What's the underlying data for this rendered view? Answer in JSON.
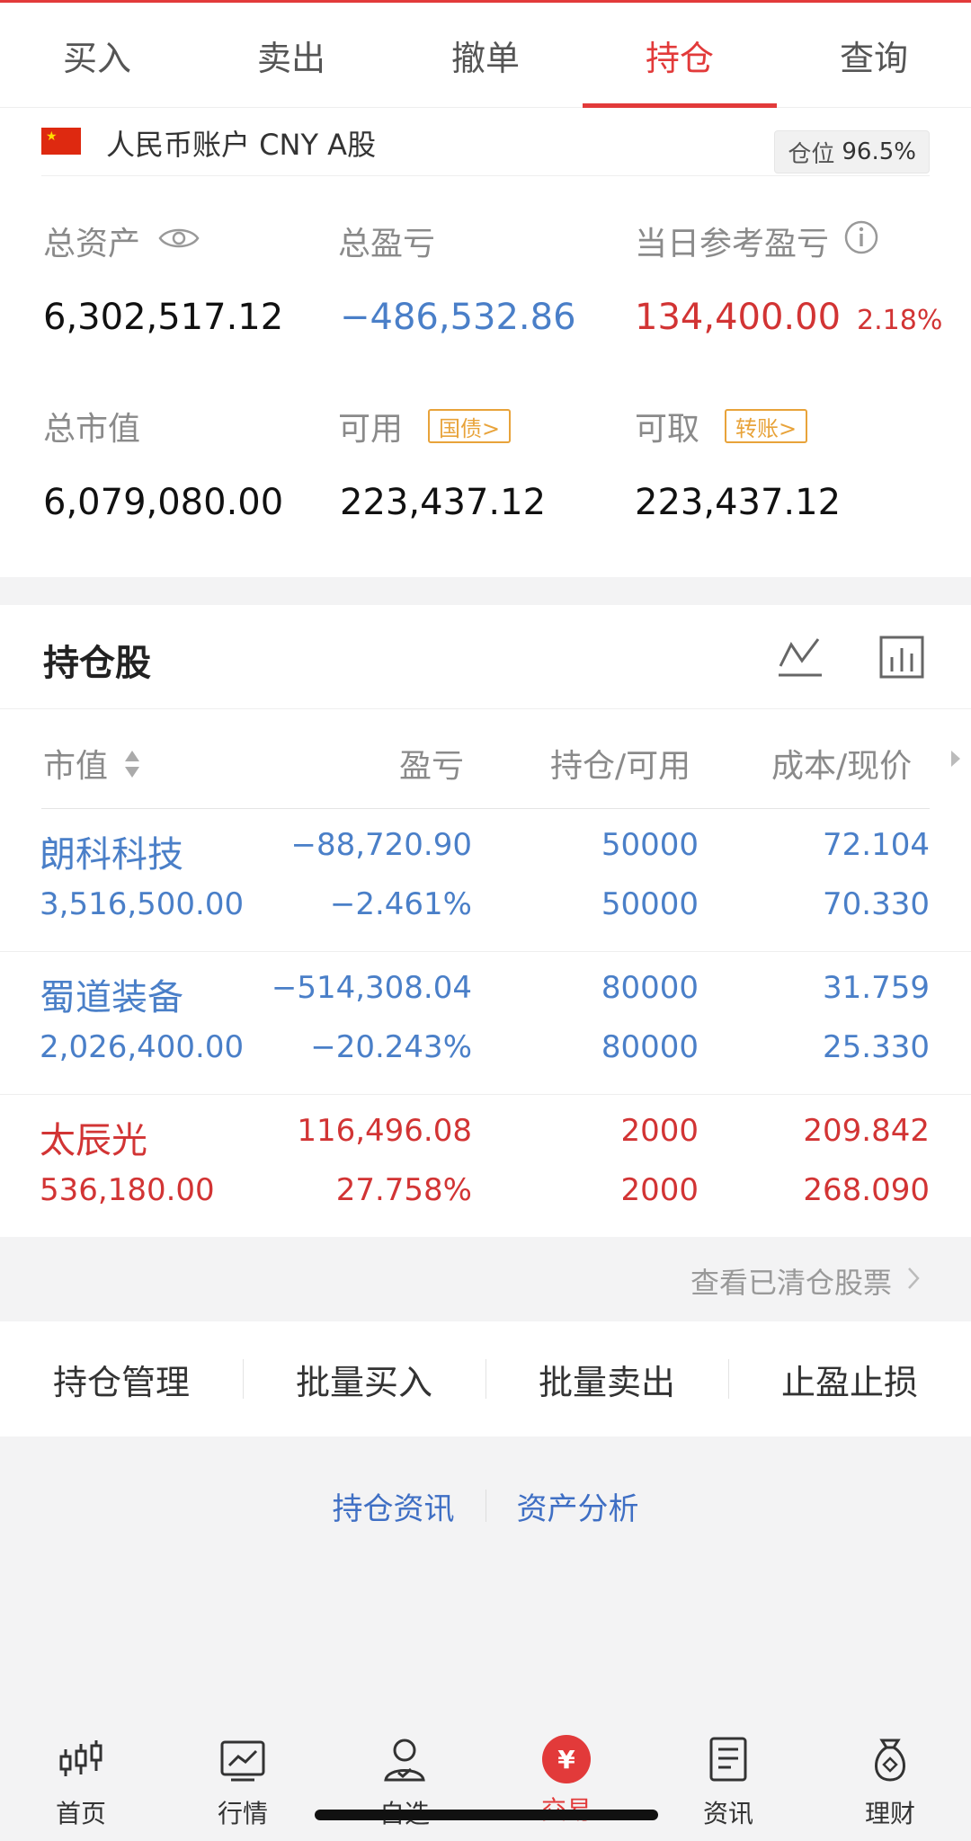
{
  "tabs": [
    "买入",
    "卖出",
    "撤单",
    "持仓",
    "查询"
  ],
  "active_tab": 3,
  "account": {
    "name": "人民币账户 CNY A股",
    "position_label": "仓位",
    "position_value": "96.5%",
    "total_assets_label": "总资产",
    "total_assets": "6,302,517.12",
    "total_pl_label": "总盈亏",
    "total_pl": "−486,532.86",
    "day_pl_label": "当日参考盈亏",
    "day_pl": "134,400.00",
    "day_pl_pct": "2.18%",
    "market_value_label": "总市值",
    "market_value": "6,079,080.00",
    "available_label": "可用",
    "available_tag": "国债>",
    "available": "223,437.12",
    "withdrawable_label": "可取",
    "withdrawable_tag": "转账>",
    "withdrawable": "223,437.12"
  },
  "holdings": {
    "title": "持仓股",
    "columns": [
      "市值",
      "盈亏",
      "持仓/可用",
      "成本/现价"
    ],
    "rows": [
      {
        "name": "朗科科技",
        "market_value": "3,516,500.00",
        "pl": "−88,720.90",
        "pl_pct": "−2.461%",
        "position": "50000",
        "available": "50000",
        "cost": "72.104",
        "price": "70.330",
        "color": "blue"
      },
      {
        "name": "蜀道装备",
        "market_value": "2,026,400.00",
        "pl": "−514,308.04",
        "pl_pct": "−20.243%",
        "position": "80000",
        "available": "80000",
        "cost": "31.759",
        "price": "25.330",
        "color": "blue"
      },
      {
        "name": "太辰光",
        "market_value": "536,180.00",
        "pl": "116,496.08",
        "pl_pct": "27.758%",
        "position": "2000",
        "available": "2000",
        "cost": "209.842",
        "price": "268.090",
        "color": "red"
      }
    ]
  },
  "cleared_link": "查看已清仓股票",
  "actions": [
    "持仓管理",
    "批量买入",
    "批量卖出",
    "止盈止损"
  ],
  "links": [
    "持仓资讯",
    "资产分析"
  ],
  "nav": [
    {
      "label": "首页",
      "icon": "candlestick-icon"
    },
    {
      "label": "行情",
      "icon": "chart-icon"
    },
    {
      "label": "自选",
      "icon": "person-icon"
    },
    {
      "label": "交易",
      "icon": "yuan-icon"
    },
    {
      "label": "资讯",
      "icon": "document-icon"
    },
    {
      "label": "理财",
      "icon": "moneybag-icon"
    }
  ],
  "colors": {
    "accent": "#e23a3a",
    "loss": "#4a7fc8",
    "gain": "#d23434",
    "tag": "#e8a33a"
  }
}
